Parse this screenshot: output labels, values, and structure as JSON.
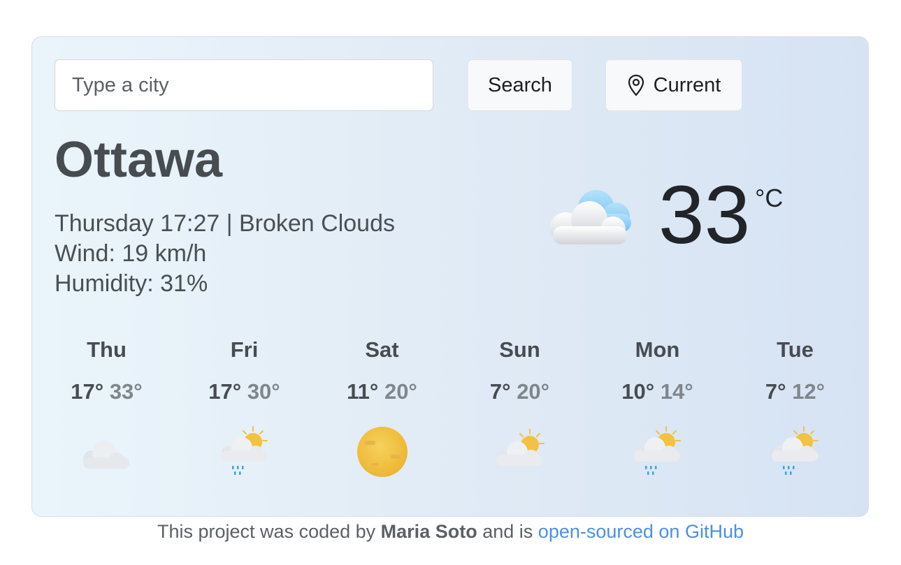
{
  "search": {
    "placeholder": "Type a city",
    "search_label": "Search",
    "current_label": "Current"
  },
  "current": {
    "city": "Ottawa",
    "day": "Thursday",
    "time": "17:27",
    "description": "Broken Clouds",
    "date_line": "Thursday 17:27 | Broken Clouds",
    "wind_line": "Wind: 19 km/h",
    "humidity_line": "Humidity: 31%",
    "temperature": "33",
    "unit": "°C",
    "icon": "broken-clouds-icon"
  },
  "forecast": [
    {
      "day": "Thu",
      "min": "17°",
      "max": "33°",
      "icon": "cloud-icon"
    },
    {
      "day": "Fri",
      "min": "17°",
      "max": "30°",
      "icon": "sun-cloud-rain-icon"
    },
    {
      "day": "Sat",
      "min": "11°",
      "max": "20°",
      "icon": "sun-icon"
    },
    {
      "day": "Sun",
      "min": "7°",
      "max": "20°",
      "icon": "sun-cloud-icon"
    },
    {
      "day": "Mon",
      "min": "10°",
      "max": "14°",
      "icon": "sun-cloud-rain-icon"
    },
    {
      "day": "Tue",
      "min": "7°",
      "max": "12°",
      "icon": "sun-cloud-rain-icon"
    }
  ],
  "footer": {
    "prefix": "This project was coded by",
    "author": "Maria Soto",
    "middle": "and is",
    "link_text": "open-sourced on GitHub"
  },
  "colors": {
    "link": "#4a90e2",
    "sun": "#f2c240",
    "cloud": "#eef0f3",
    "cloud_blue": "#8fcdf2",
    "rain": "#3aa0e0"
  }
}
